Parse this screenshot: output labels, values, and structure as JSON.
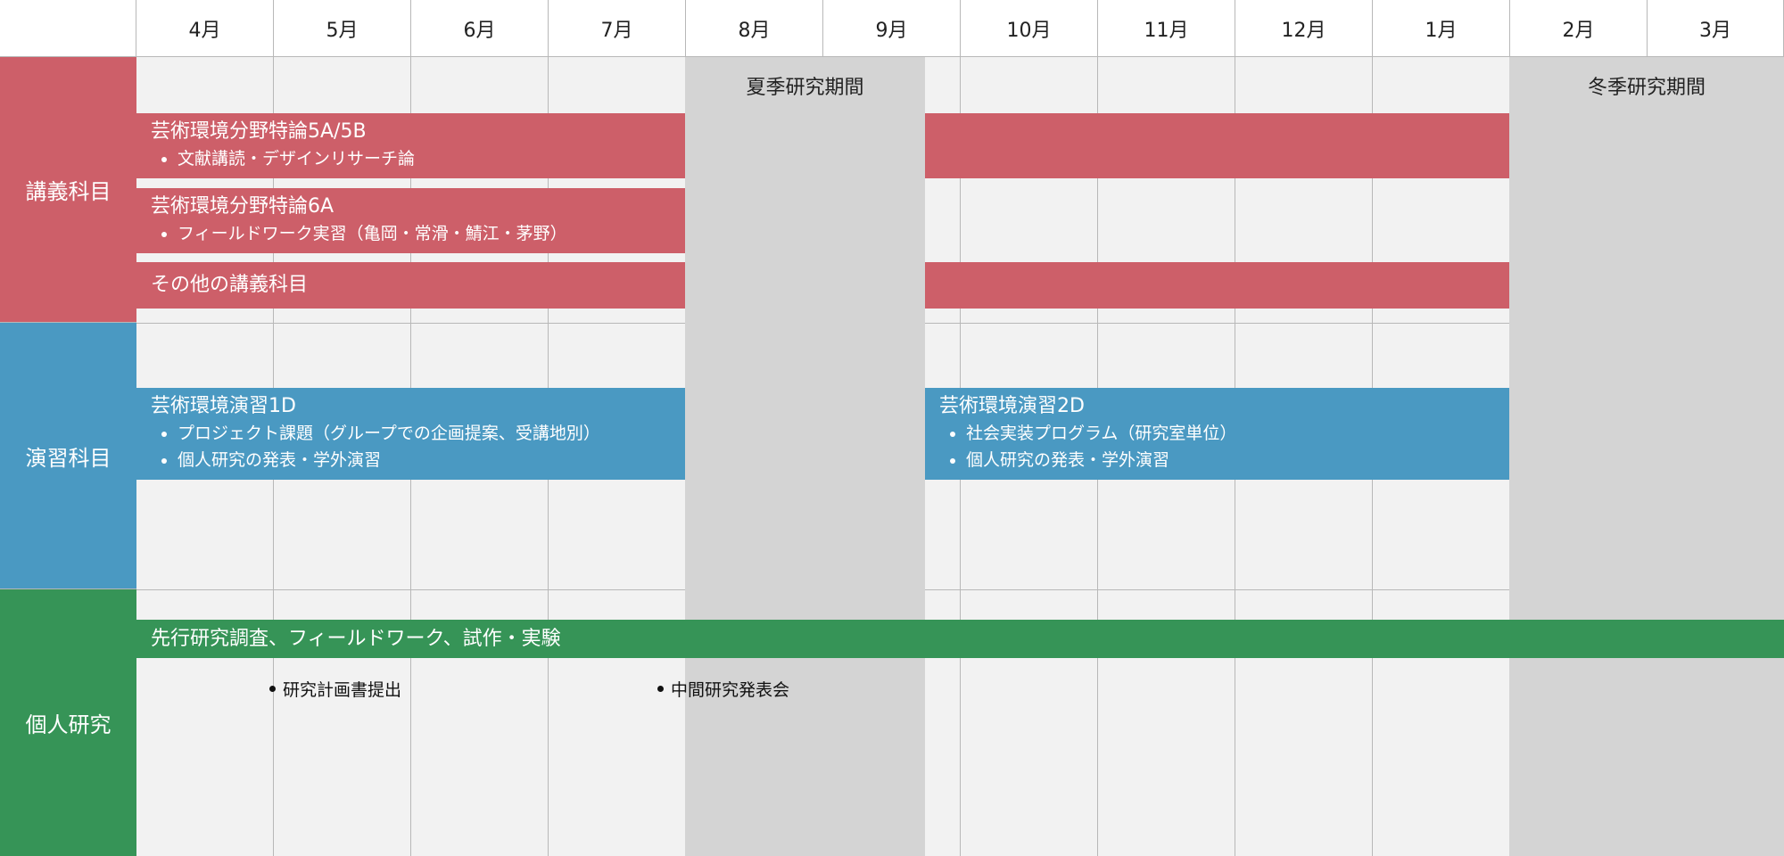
{
  "months": [
    "4月",
    "5月",
    "6月",
    "7月",
    "8月",
    "9月",
    "10月",
    "11月",
    "12月",
    "1月",
    "2月",
    "3月"
  ],
  "periods": [
    {
      "label": "夏季研究期間"
    },
    {
      "label": "冬季研究期間"
    }
  ],
  "categories": [
    {
      "label": "講義科目",
      "color": "#cd5f69"
    },
    {
      "label": "演習科目",
      "color": "#4a99c2"
    },
    {
      "label": "個人研究",
      "color": "#369457"
    }
  ],
  "bars": {
    "lecture_1": {
      "title": "芸術環境分野特論5A/5B",
      "items": [
        "文献講読・デザインリサーチ論"
      ]
    },
    "lecture_2": {
      "title": "芸術環境分野特論6A",
      "items": [
        "フィールドワーク実習（亀岡・常滑・鯖江・茅野）"
      ]
    },
    "lecture_3": {
      "title": "その他の講義科目"
    },
    "seminar_1": {
      "title": "芸術環境演習1D",
      "items": [
        "プロジェクト課題（グループでの企画提案、受講地別）",
        "個人研究の発表・学外演習"
      ]
    },
    "seminar_2": {
      "title": "芸術環境演習2D",
      "items": [
        "社会実装プログラム（研究室単位）",
        "個人研究の発表・学外演習"
      ]
    },
    "research": {
      "title": "先行研究調査、フィールドワーク、試作・実験"
    }
  },
  "milestones": [
    {
      "label": "研究計画書提出"
    },
    {
      "label": "中間研究発表会"
    }
  ],
  "colors": {
    "lecture": "#cd5f69",
    "seminar": "#4a99c2",
    "research": "#369457",
    "period_bg": "#d4d4d4",
    "grid_bg": "#f2f2f2"
  }
}
